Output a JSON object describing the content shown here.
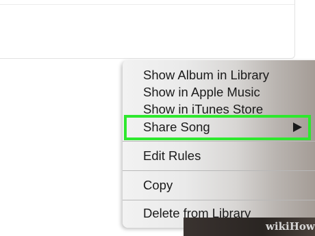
{
  "menu": {
    "items": [
      {
        "label": "Show Album in Library"
      },
      {
        "label": "Show in Apple Music"
      },
      {
        "label": "Show in iTunes Store"
      },
      {
        "label": "Share Song",
        "has_submenu": true,
        "highlighted": true
      },
      {
        "label": "Edit Rules"
      },
      {
        "label": "Copy"
      },
      {
        "label": "Delete from Library"
      }
    ],
    "submenu_icon": "triangle-right-icon"
  },
  "watermark": "wikiHow",
  "colors": {
    "highlight": "#2ee82e",
    "menu_text": "#1a1a1a"
  }
}
